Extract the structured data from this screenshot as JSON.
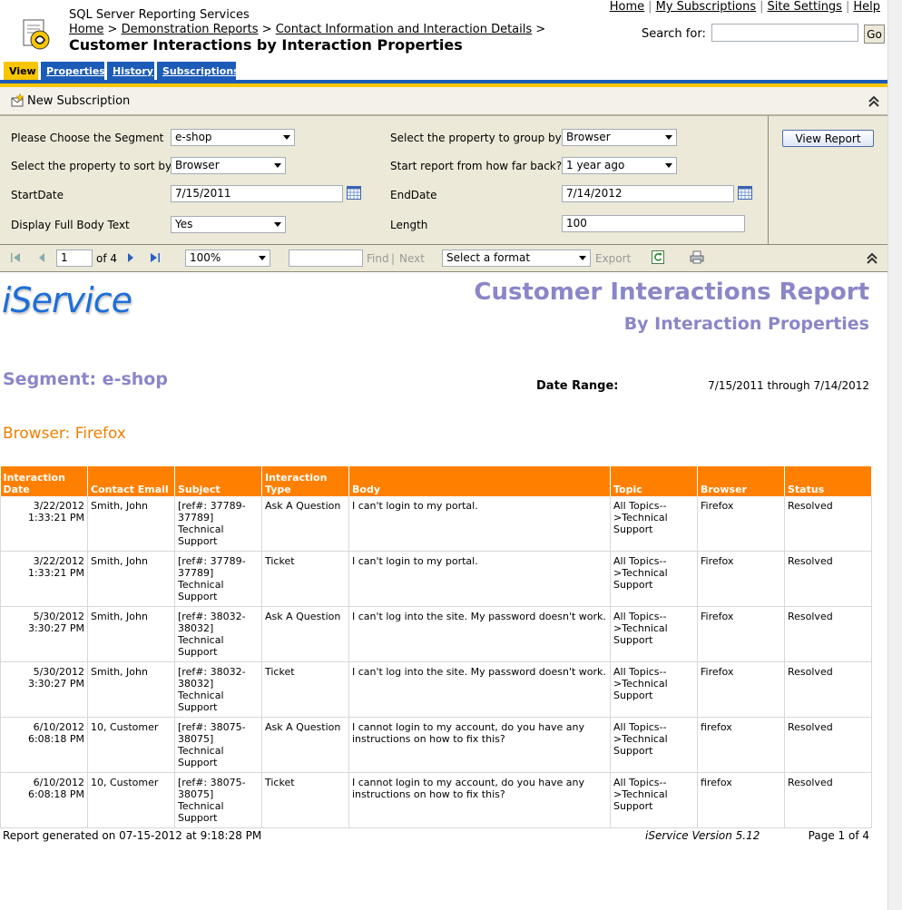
{
  "header": {
    "app_title": "SQL Server Reporting Services",
    "breadcrumb": [
      "Home",
      "Demonstration Reports",
      "Contact Information and Interaction Details"
    ],
    "breadcrumb_sep": ">",
    "page_title": "Customer Interactions by Interaction Properties",
    "top_links": [
      "Home",
      "My Subscriptions",
      "Site Settings",
      "Help"
    ],
    "top_links_sep": "|",
    "search_label": "Search for:",
    "search_value": "",
    "go_label": "Go"
  },
  "tabs": [
    {
      "label": "View",
      "active": true
    },
    {
      "label": "Properties",
      "active": false
    },
    {
      "label": "History",
      "active": false
    },
    {
      "label": "Subscriptions",
      "active": false
    }
  ],
  "subscription_bar": {
    "new_subscription_label": "New Subscription"
  },
  "parameters": {
    "segment_label": "Please Choose the Segment",
    "segment_value": "e-shop",
    "sort_label": "Select the property to sort by",
    "sort_value": "Browser",
    "startdate_label": "StartDate",
    "startdate_value": "7/15/2011",
    "fullbody_label": "Display Full Body Text",
    "fullbody_value": "Yes",
    "groupby_label": "Select the property to group by",
    "groupby_value": "Browser",
    "howfar_label": "Start report from how far back?",
    "howfar_value": "1 year ago",
    "enddate_label": "EndDate",
    "enddate_value": "7/14/2012",
    "length_label": "Length",
    "length_value": "100",
    "view_report_label": "View Report"
  },
  "toolbar": {
    "page_value": "1",
    "page_of": "of 4",
    "zoom_value": "100%",
    "find_value": "",
    "find_label": "Find",
    "find_sep": "|",
    "next_label": "Next",
    "format_value": "Select a format",
    "export_label": "Export"
  },
  "report": {
    "brand": "iService",
    "title": "Customer Interactions Report",
    "subtitle": "By Interaction Properties",
    "segment_heading": "Segment: e-shop",
    "date_range_label": "Date Range:",
    "date_range_value": "7/15/2011 through 7/14/2012",
    "group_heading": "Browser: Firefox",
    "columns": [
      "Interaction Date",
      "Contact Email",
      "Subject",
      "Interaction Type",
      "Body",
      "Topic",
      "Browser",
      "Status"
    ],
    "rows": [
      [
        "3/22/2012 1:33:21 PM",
        "Smith, John",
        "[ref#: 37789-37789] Technical Support",
        "Ask A Question",
        "I can't login to my portal.",
        "All Topics-->Technical Support",
        "Firefox",
        "Resolved"
      ],
      [
        "3/22/2012 1:33:21 PM",
        "Smith, John",
        "[ref#: 37789-37789] Technical Support",
        "Ticket",
        "I can't login to my portal.",
        "All Topics-->Technical Support",
        "Firefox",
        "Resolved"
      ],
      [
        "5/30/2012 3:30:27 PM",
        "Smith, John",
        "[ref#: 38032-38032] Technical Support",
        "Ask A Question",
        "I can't log into the site. My password doesn't work.",
        "All Topics-->Technical Support",
        "Firefox",
        "Resolved"
      ],
      [
        "5/30/2012 3:30:27 PM",
        "Smith, John",
        "[ref#: 38032-38032] Technical Support",
        "Ticket",
        "I can't log into the site. My password doesn't work.",
        "All Topics-->Technical Support",
        "Firefox",
        "Resolved"
      ],
      [
        "6/10/2012 6:08:18 PM",
        "10, Customer",
        "[ref#: 38075-38075] Technical Support",
        "Ask A Question",
        "I cannot login to my account, do you have any instructions on how to fix this?",
        "All Topics-->Technical Support",
        "firefox",
        "Resolved"
      ],
      [
        "6/10/2012 6:08:18 PM",
        "10, Customer",
        "[ref#: 38075-38075] Technical Support",
        "Ticket",
        "I cannot login to my account, do you have any instructions on how to fix this?",
        "All Topics-->Technical Support",
        "firefox",
        "Resolved"
      ]
    ],
    "footer_generated": "Report generated on 07-15-2012 at 9:18:28 PM",
    "footer_version": "iService Version 5.12",
    "footer_page": "Page 1 of 4"
  },
  "colors": {
    "tab_active": "#f7c600",
    "tab_inactive": "#1c5bb8",
    "table_header": "#ff8000",
    "report_title": "#8a86c8",
    "group_heading": "#f07f00",
    "brand": "#1e6fd6"
  }
}
